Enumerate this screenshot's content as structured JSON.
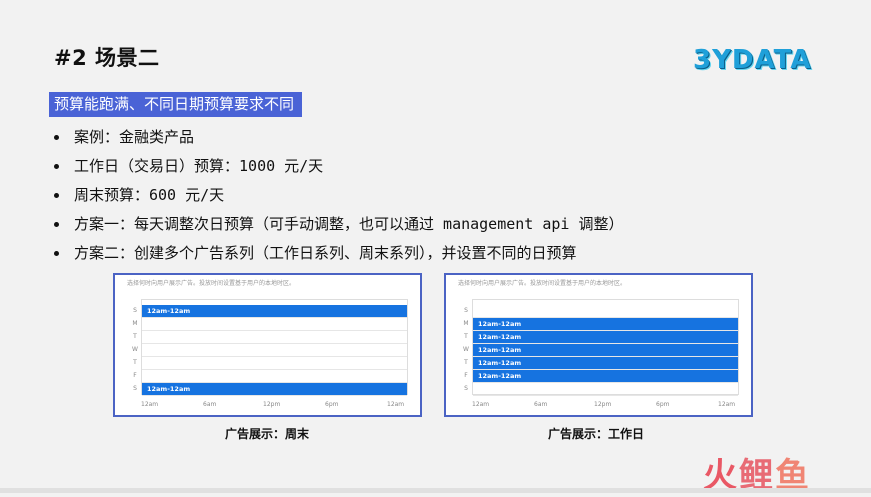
{
  "slide": {
    "title": "#2 场景二",
    "logo": "3YDATA",
    "highlight": "预算能跑满、不同日期预算要求不同",
    "bullets": [
      "案例：金融类产品",
      "工作日（交易日）预算：1000 元/天",
      "周末预算：600 元/天",
      "方案一：每天调整次日预算（可手动调整，也可以通过 management api 调整）",
      "方案二：创建多个广告系列（工作日系列、周末系列），并设置不同的日预算"
    ]
  },
  "panels": {
    "hint": "选择何时向用户展示广告。投放时间设置基于用户的本地时区。",
    "day_labels": [
      "S",
      "M",
      "T",
      "W",
      "T",
      "F",
      "S"
    ],
    "x_labels": [
      "12am",
      "6am",
      "12pm",
      "6pm",
      "12am"
    ],
    "bar_label": "12am-12am",
    "weekend": {
      "caption": "广告展示：周末",
      "active_days": [
        0,
        6
      ]
    },
    "weekday": {
      "caption": "广告展示：工作日",
      "active_days": [
        1,
        2,
        3,
        4,
        5
      ]
    }
  },
  "watermark": {
    "chars": [
      "火",
      "鲤",
      "鱼"
    ]
  },
  "colors": {
    "accent": "#4a63d6",
    "bar": "#1673e0",
    "panel_border": "#4b63c4",
    "watermark": "#e94b5a"
  }
}
